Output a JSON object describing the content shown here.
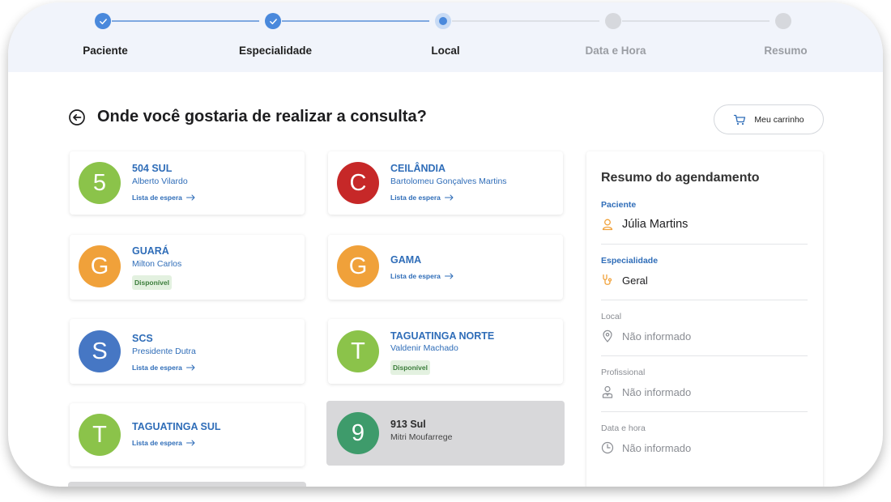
{
  "stepper": {
    "steps": [
      {
        "label": "Paciente",
        "state": "done"
      },
      {
        "label": "Especialidade",
        "state": "done"
      },
      {
        "label": "Local",
        "state": "current"
      },
      {
        "label": "Data e Hora",
        "state": "todo"
      },
      {
        "label": "Resumo",
        "state": "todo"
      }
    ]
  },
  "header": {
    "title": "Onde você gostaria de realizar a consulta?",
    "back_icon": "arrow-left-circle-icon",
    "cart_label": "Meu carrinho",
    "cart_icon": "cart-icon"
  },
  "locations": [
    {
      "initial": "5",
      "name": "504 SUL",
      "doctor": "Alberto Vilardo",
      "link": "Lista de espera",
      "color": "#8bc34a"
    },
    {
      "initial": "C",
      "name": "CEILÂNDIA",
      "doctor": "Bartolomeu Gonçalves Martins",
      "link": "Lista de espera",
      "color": "#c62828"
    },
    {
      "initial": "G",
      "name": "GUARÁ",
      "doctor": "Milton Carlos",
      "badge": "Disponível",
      "color": "#f0a13a"
    },
    {
      "initial": "G",
      "name": "GAMA",
      "link": "Lista de espera",
      "color": "#f0a13a"
    },
    {
      "initial": "S",
      "name": "SCS",
      "doctor": "Presidente Dutra",
      "link": "Lista de espera",
      "color": "#4677c4"
    },
    {
      "initial": "T",
      "name": "TAGUATINGA NORTE",
      "doctor": "Valdenir Machado",
      "badge": "Disponível",
      "color": "#8bc34a"
    },
    {
      "initial": "T",
      "name": "TAGUATINGA SUL",
      "link": "Lista de espera",
      "color": "#8bc34a"
    },
    {
      "initial": "9",
      "name": "913 Sul",
      "doctor": "Mitri Moufarrege",
      "color": "#3e9b6b",
      "disabled": true
    }
  ],
  "summary": {
    "title": "Resumo do agendamento",
    "patient_label": "Paciente",
    "patient_value": "Júlia Martins",
    "specialty_label": "Especialidade",
    "specialty_value": "Geral",
    "place_label": "Local",
    "place_value": "Não informado",
    "professional_label": "Profissional",
    "professional_value": "Não informado",
    "datetime_label": "Data e hora",
    "datetime_value": "Não informado"
  },
  "colors": {
    "accent": "#4a89dc",
    "link": "#2f6db8",
    "icon_accent": "#f0a13a"
  }
}
